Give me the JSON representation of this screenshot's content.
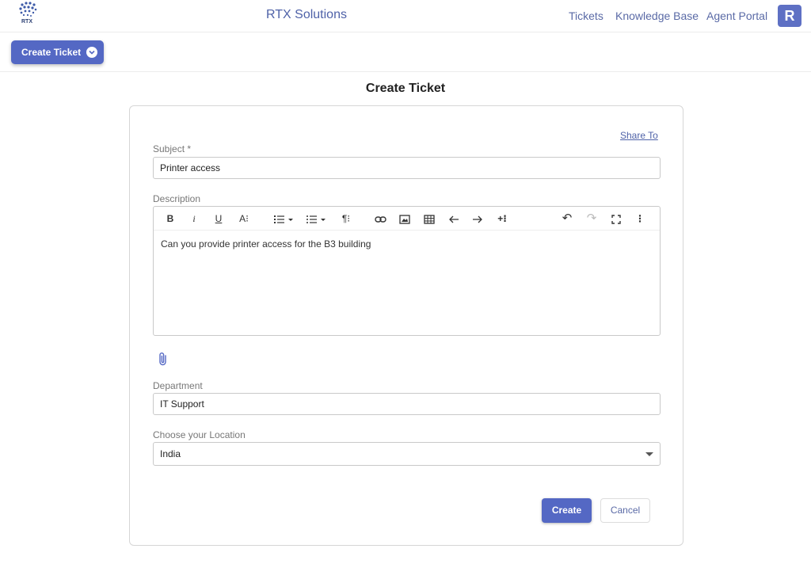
{
  "header": {
    "logo_text": "RTX",
    "brand": "RTX Solutions",
    "nav": [
      "Tickets",
      "Knowledge Base",
      "Agent Portal"
    ],
    "avatar_letter": "R"
  },
  "subbar": {
    "create_ticket_label": "Create Ticket"
  },
  "page": {
    "title": "Create Ticket"
  },
  "form": {
    "share_to": "Share To",
    "subject_label": "Subject *",
    "subject_value": "Printer access",
    "description_label": "Description",
    "description_value": "Can you provide printer access for the B3 building",
    "department_label": "Department",
    "department_value": "IT Support",
    "location_label": "Choose your Location",
    "location_value": "India",
    "create_label": "Create",
    "cancel_label": "Cancel"
  },
  "toolbar": {
    "bold": "B",
    "italic": "i",
    "underline": "U",
    "font_size": "A⁝",
    "paragraph": "¶⁝",
    "insert_more": "+⁝",
    "more": "⋮",
    "redo": "↷",
    "undo": "↶"
  },
  "colors": {
    "primary": "#5468c4",
    "brand_text": "#4f62a8"
  }
}
